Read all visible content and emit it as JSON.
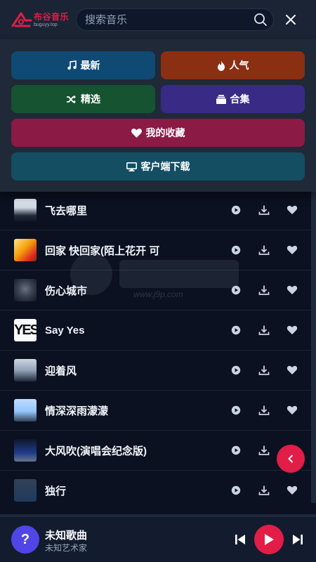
{
  "header": {
    "logo_cn": "布谷音乐",
    "logo_en": "buguyy.top",
    "search_placeholder": "搜索音乐"
  },
  "menu": {
    "latest": "最新",
    "popular": "人气",
    "selected": "精选",
    "collection": "合集",
    "favorites": "我的收藏",
    "download_client": "客户端下载"
  },
  "colors": {
    "latest": "#0e4a74",
    "popular": "#8a2f12",
    "selected": "#165331",
    "collection": "#392a86",
    "favorites": "#8b1a44",
    "download_client": "#134e63",
    "accent": "#e11d48"
  },
  "songs": [
    {
      "title": "",
      "cover": "partial"
    },
    {
      "title": "飞去哪里",
      "cover": "portrait"
    },
    {
      "title": "回家 快回家(陌上花开 可",
      "cover": "poster"
    },
    {
      "title": "伤心城市",
      "cover": "dark-photo"
    },
    {
      "title": "Say Yes",
      "cover": "text-yes"
    },
    {
      "title": "迎着风",
      "cover": "landscape"
    },
    {
      "title": "情深深雨濛濛",
      "cover": "rain"
    },
    {
      "title": "大风吹(演唱会纪念版)",
      "cover": "night"
    },
    {
      "title": "独行",
      "cover": "partial"
    }
  ],
  "watermark": {
    "domain": "www.j9p.com"
  },
  "player": {
    "avatar_symbol": "?",
    "title": "未知歌曲",
    "artist": "未知艺术家"
  }
}
